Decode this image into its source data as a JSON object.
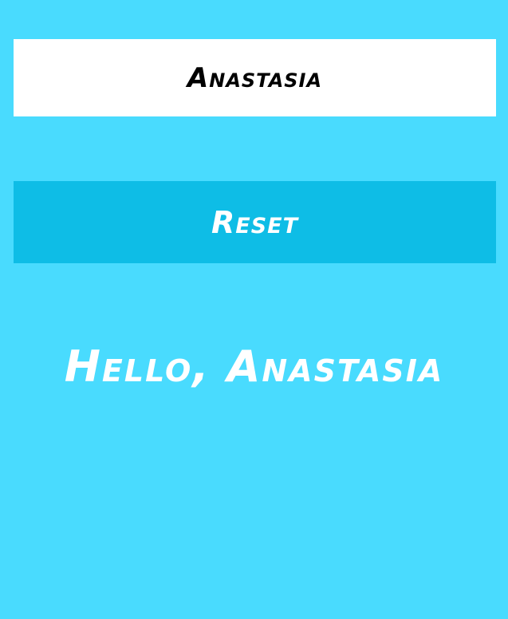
{
  "name_input": {
    "value": "Anastasia"
  },
  "reset_button": {
    "label": "Reset"
  },
  "greeting": {
    "text": "Hello, Anastasia"
  },
  "colors": {
    "background": "#49dbfe",
    "input_background": "#ffffff",
    "button_background": "#0ebde6",
    "text_light": "#ffffff",
    "text_dark": "#000000"
  }
}
